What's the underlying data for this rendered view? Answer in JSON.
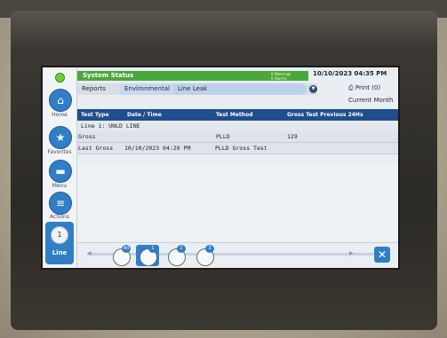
{
  "nav": {
    "items": [
      {
        "label": "Home",
        "icon": "home-icon"
      },
      {
        "label": "Favorites",
        "icon": "star-icon"
      },
      {
        "label": "Menu",
        "icon": "menu-icon"
      },
      {
        "label": "Actions",
        "icon": "actions-icon"
      }
    ],
    "line_label": "Line",
    "line_num": "1"
  },
  "header": {
    "status": "System Status",
    "warnings": "0 Warnings",
    "alarms": "0 Alarms",
    "datetime": "10/10/2023 04:35 PM"
  },
  "tabs": [
    {
      "label": "Reports"
    },
    {
      "label": "Environmental"
    },
    {
      "label": "Line Leak"
    }
  ],
  "print_label": "Print (0)",
  "period": "Current Month",
  "table": {
    "headers": [
      "Test Type",
      "Date / Time",
      "Test Method",
      "Gross Test Previous 24Hs"
    ],
    "section": "Line 1: UNLD LINE",
    "rows": [
      [
        "Gross",
        "",
        "PLLD",
        "129"
      ],
      [
        "Last Gross",
        "10/10/2023 04:20 PM",
        "PLLD Gross Test",
        ""
      ]
    ]
  },
  "selectors": [
    {
      "num": "All"
    },
    {
      "num": "1"
    },
    {
      "num": "2"
    },
    {
      "num": "3"
    }
  ],
  "colors": {
    "status_green": "#4aa83a",
    "header_blue": "#1f4e8c",
    "accent_blue": "#2f7fc8"
  }
}
